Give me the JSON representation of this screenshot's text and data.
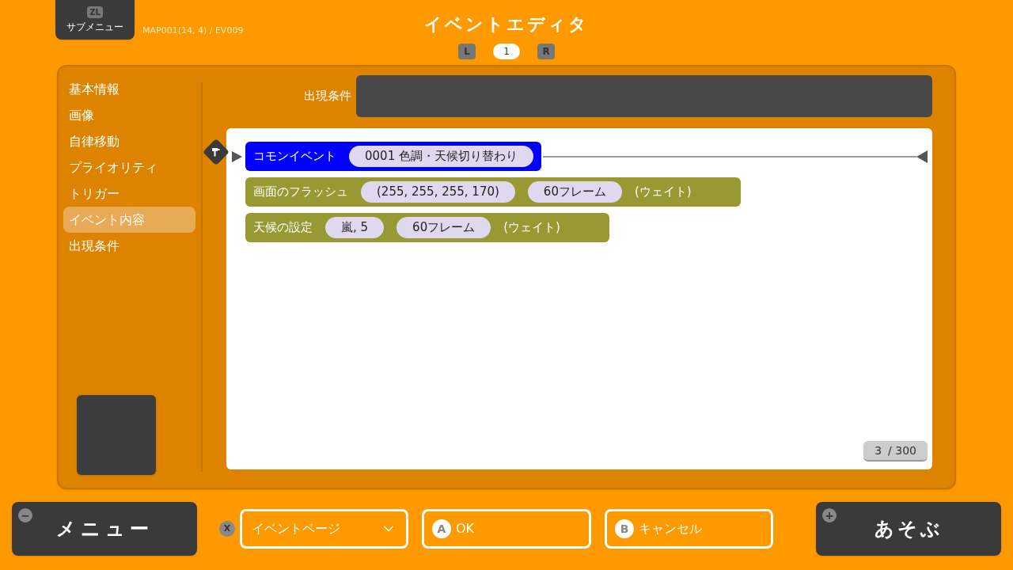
{
  "header": {
    "submenu_button": {
      "key": "ZL",
      "label": "サブメニュー"
    },
    "location": "MAP001(14, 4) / EV009",
    "title": "イベントエディタ",
    "page_nav": {
      "prev_key": "L",
      "page": "1",
      "next_key": "R"
    }
  },
  "sidebar": {
    "items": [
      {
        "label": "基本情報",
        "selected": false
      },
      {
        "label": "画像",
        "selected": false
      },
      {
        "label": "自律移動",
        "selected": false
      },
      {
        "label": "プライオリティ",
        "selected": false
      },
      {
        "label": "トリガー",
        "selected": false
      },
      {
        "label": "イベント内容",
        "selected": true
      },
      {
        "label": "出現条件",
        "selected": false
      }
    ]
  },
  "condition": {
    "label": "出現条件"
  },
  "commands": [
    {
      "name": "コモンイベント",
      "params": [
        "0001 色調・天候切り替わり"
      ],
      "selected": true
    },
    {
      "name": "画面のフラッシュ",
      "params": [
        "(255, 255, 255, 170)",
        "60フレーム"
      ],
      "suffix": "(ウェイト)",
      "selected": false
    },
    {
      "name": "天候の設定",
      "params": [
        "嵐, 5",
        "60フレーム"
      ],
      "suffix": "(ウェイト)",
      "selected": false
    }
  ],
  "counter": {
    "current": "3",
    "total": "/ 300"
  },
  "footer": {
    "menu_button": {
      "key": "−",
      "label": "メニュー"
    },
    "page_select": {
      "key": "X",
      "value": "イベントページ"
    },
    "ok_button": {
      "key": "A",
      "label": "OK"
    },
    "cancel_button": {
      "key": "B",
      "label": "キャンセル"
    },
    "play_button": {
      "key": "+",
      "label": "あそぶ"
    }
  }
}
